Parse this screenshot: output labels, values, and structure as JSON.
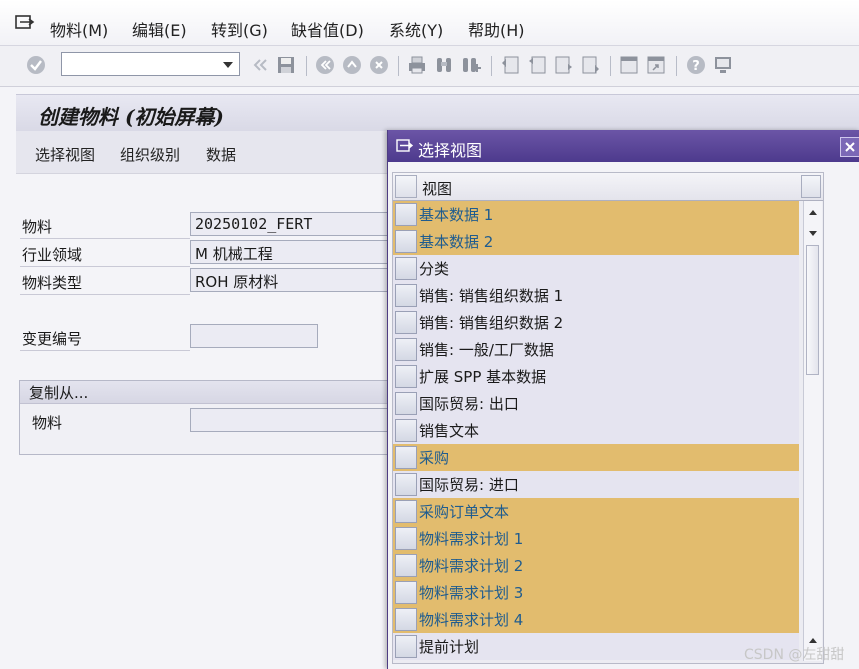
{
  "menu": {
    "items": [
      "物料(M)",
      "编辑(E)",
      "转到(G)",
      "缺省值(D)",
      "系统(Y)",
      "帮助(H)"
    ]
  },
  "toolbar": {
    "command_field_value": "",
    "icons": [
      "check-icon",
      "command-dropdown",
      "back-double-icon",
      "save-icon",
      "nav-back-icon",
      "nav-exit-icon",
      "nav-cancel-icon",
      "print-icon",
      "find-icon",
      "find-next-icon",
      "first-page-icon",
      "prev-page-icon",
      "next-page-icon",
      "last-page-icon",
      "new-session-icon",
      "shortcut-icon",
      "help-icon",
      "layout-icon"
    ]
  },
  "page": {
    "title": "创建物料 (初始屏幕)",
    "app_buttons": [
      "选择视图",
      "组织级别",
      "数据"
    ]
  },
  "form": {
    "material_label": "物料",
    "material_value": "20250102_FERT",
    "industry_label": "行业领域",
    "industry_value": "M 机械工程",
    "type_label": "物料类型",
    "type_value": "ROH 原材料",
    "change_label": "变更编号",
    "change_value": "",
    "copy_from_title": "复制从...",
    "copy_material_label": "物料",
    "copy_material_value": ""
  },
  "dialog": {
    "title": "选择视图",
    "column_header": "视图",
    "rows": [
      {
        "label": "基本数据 1",
        "selected": true
      },
      {
        "label": "基本数据 2",
        "selected": true
      },
      {
        "label": "分类",
        "selected": false
      },
      {
        "label": "销售: 销售组织数据 1",
        "selected": false
      },
      {
        "label": "销售: 销售组织数据 2",
        "selected": false
      },
      {
        "label": "销售: 一般/工厂数据",
        "selected": false
      },
      {
        "label": "扩展 SPP 基本数据",
        "selected": false
      },
      {
        "label": "国际贸易: 出口",
        "selected": false
      },
      {
        "label": "销售文本",
        "selected": false
      },
      {
        "label": "采购",
        "selected": true
      },
      {
        "label": "国际贸易: 进口",
        "selected": false
      },
      {
        "label": "采购订单文本",
        "selected": true
      },
      {
        "label": "物料需求计划 1",
        "selected": true
      },
      {
        "label": "物料需求计划 2",
        "selected": true
      },
      {
        "label": "物料需求计划 3",
        "selected": true
      },
      {
        "label": "物料需求计划 4",
        "selected": true
      },
      {
        "label": "提前计划",
        "selected": false
      }
    ]
  },
  "watermark": "CSDN @左甜甜",
  "colors": {
    "selected_row": "#e2bc6e",
    "selected_text": "#1f5c8f",
    "dialog_title_bg": "#5a449a"
  }
}
